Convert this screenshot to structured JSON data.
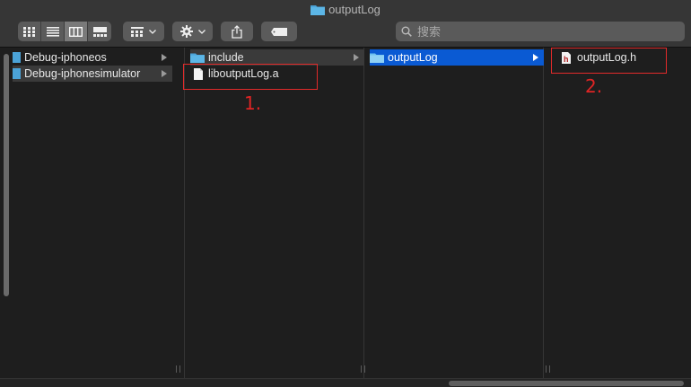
{
  "window": {
    "title": "outputLog"
  },
  "search": {
    "placeholder": "搜索"
  },
  "columns": [
    {
      "items": [
        {
          "name": "Debug-iphoneos",
          "type": "folder",
          "selected": false
        },
        {
          "name": "Debug-iphonesimulator",
          "type": "folder",
          "selected": true
        }
      ]
    },
    {
      "items": [
        {
          "name": "include",
          "type": "folder",
          "selected": true
        },
        {
          "name": "liboutputLog.a",
          "type": "file",
          "selected": false
        }
      ]
    },
    {
      "items": [
        {
          "name": "outputLog",
          "type": "folder",
          "selected": true
        }
      ]
    },
    {
      "items": [
        {
          "name": "outputLog.h",
          "type": "header-file",
          "selected": false
        }
      ]
    }
  ],
  "annotations": [
    {
      "label": "1."
    },
    {
      "label": "2."
    }
  ],
  "colors": {
    "selection_blue": "#0a5ad3",
    "annotation_red": "#e22a2a",
    "folder_blue": "#4ba3d8"
  }
}
